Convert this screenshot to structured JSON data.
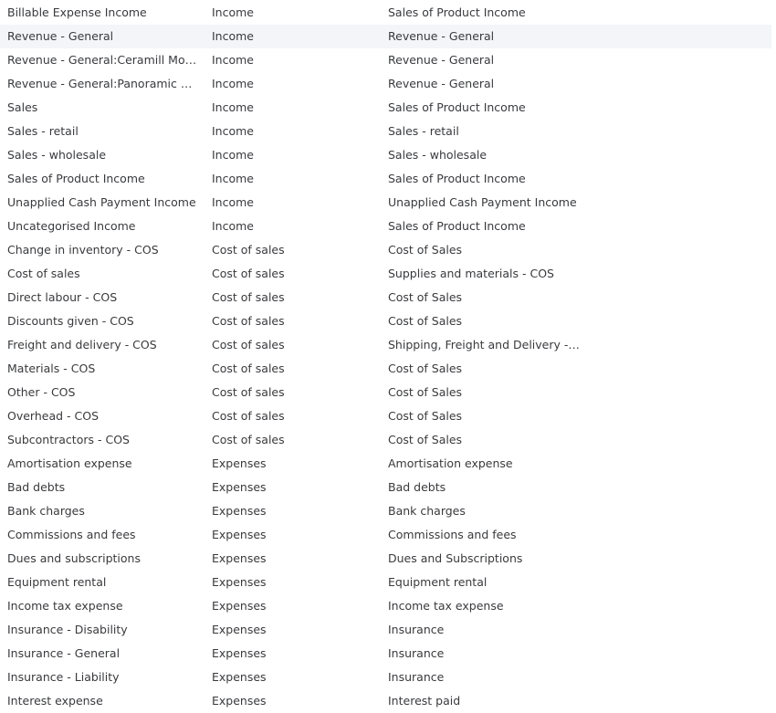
{
  "accounts": {
    "highlighted_index": 1,
    "rows": [
      {
        "name": "Billable Expense Income",
        "type": "Income",
        "detail": "Sales of Product Income"
      },
      {
        "name": "Revenue - General",
        "type": "Income",
        "detail": "Revenue - General"
      },
      {
        "name": "Revenue - General:Ceramill Mot…",
        "type": "Income",
        "detail": "Revenue - General"
      },
      {
        "name": "Revenue - General:Panoramic d…",
        "type": "Income",
        "detail": "Revenue - General"
      },
      {
        "name": "Sales",
        "type": "Income",
        "detail": "Sales of Product Income"
      },
      {
        "name": "Sales - retail",
        "type": "Income",
        "detail": "Sales - retail"
      },
      {
        "name": "Sales - wholesale",
        "type": "Income",
        "detail": "Sales - wholesale"
      },
      {
        "name": "Sales of Product Income",
        "type": "Income",
        "detail": "Sales of Product Income"
      },
      {
        "name": "Unapplied Cash Payment Income",
        "type": "Income",
        "detail": "Unapplied Cash Payment Income"
      },
      {
        "name": "Uncategorised Income",
        "type": "Income",
        "detail": "Sales of Product Income"
      },
      {
        "name": "Change in inventory - COS",
        "type": "Cost of sales",
        "detail": "Cost of Sales"
      },
      {
        "name": "Cost of sales",
        "type": "Cost of sales",
        "detail": "Supplies and materials - COS"
      },
      {
        "name": "Direct labour - COS",
        "type": "Cost of sales",
        "detail": "Cost of Sales"
      },
      {
        "name": "Discounts given - COS",
        "type": "Cost of sales",
        "detail": "Cost of Sales"
      },
      {
        "name": "Freight and delivery - COS",
        "type": "Cost of sales",
        "detail": "Shipping, Freight and Delivery - …"
      },
      {
        "name": "Materials - COS",
        "type": "Cost of sales",
        "detail": "Cost of Sales"
      },
      {
        "name": "Other - COS",
        "type": "Cost of sales",
        "detail": "Cost of Sales"
      },
      {
        "name": "Overhead - COS",
        "type": "Cost of sales",
        "detail": "Cost of Sales"
      },
      {
        "name": "Subcontractors - COS",
        "type": "Cost of sales",
        "detail": "Cost of Sales"
      },
      {
        "name": "Amortisation expense",
        "type": "Expenses",
        "detail": "Amortisation expense"
      },
      {
        "name": "Bad debts",
        "type": "Expenses",
        "detail": "Bad debts"
      },
      {
        "name": "Bank charges",
        "type": "Expenses",
        "detail": "Bank charges"
      },
      {
        "name": "Commissions and fees",
        "type": "Expenses",
        "detail": "Commissions and fees"
      },
      {
        "name": "Dues and subscriptions",
        "type": "Expenses",
        "detail": "Dues and Subscriptions"
      },
      {
        "name": "Equipment rental",
        "type": "Expenses",
        "detail": "Equipment rental"
      },
      {
        "name": "Income tax expense",
        "type": "Expenses",
        "detail": "Income tax expense"
      },
      {
        "name": "Insurance - Disability",
        "type": "Expenses",
        "detail": "Insurance"
      },
      {
        "name": "Insurance - General",
        "type": "Expenses",
        "detail": "Insurance"
      },
      {
        "name": "Insurance - Liability",
        "type": "Expenses",
        "detail": "Insurance"
      },
      {
        "name": "Interest expense",
        "type": "Expenses",
        "detail": "Interest paid"
      }
    ]
  }
}
